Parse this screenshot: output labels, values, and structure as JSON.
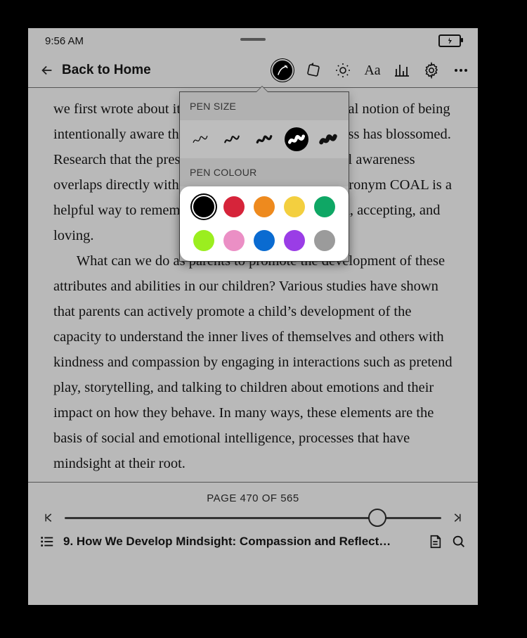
{
  "status": {
    "time": "9:56 AM"
  },
  "toolbar": {
    "back_label": "Back to Home"
  },
  "content": {
    "p1": "we first wrote about it over a decade ago, the general notion of being intentionally aware that is the science of mindfulness has blossomed. Research that the presence and openness of mindful awareness overlaps directly with the process of “coal.” The acronym COAL is a helpful way to remember this: we are curious, open, accepting, and loving.",
    "p2": "What can we do as parents to promote the development of these attributes and abilities in our children? Various studies have shown that parents can actively promote a child’s development of the capacity to understand the inner lives of themselves and others with kindness and compassion by engaging in interactions such as pretend play, storytelling, and talking to children about emotions and their impact on how they behave. In many ways, these elements are the basis of social and emotional intelligence, processes that have mindsight at their root."
  },
  "footer": {
    "page_indicator": "PAGE 470 OF 565",
    "progress_percent": 83,
    "chapter_title": "9. How We Develop Mindsight: Compassion and Reflect…"
  },
  "popover": {
    "pen_size_label": "PEN SIZE",
    "pen_colour_label": "PEN COLOUR",
    "selected_size_index": 3,
    "selected_color_index": 0,
    "colors": [
      "#000000",
      "#d6243a",
      "#ee8a1e",
      "#f3cf3f",
      "#0fa765",
      "#9bee1f",
      "#eb8fc5",
      "#0a6bd1",
      "#9a3de6",
      "#9b9b9b"
    ]
  }
}
